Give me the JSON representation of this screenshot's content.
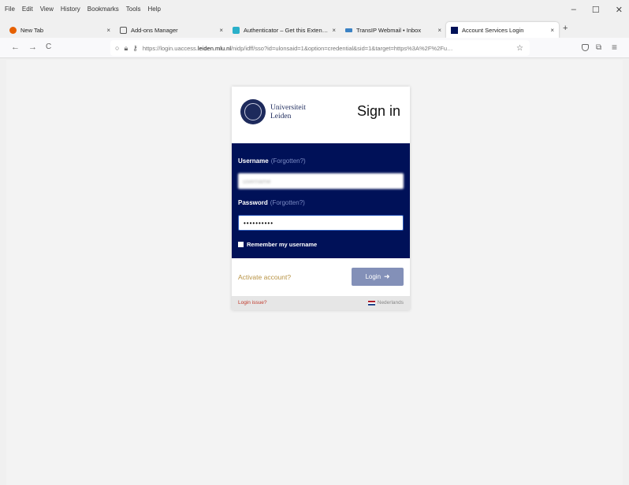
{
  "menu": [
    "File",
    "Edit",
    "View",
    "History",
    "Bookmarks",
    "Tools",
    "Help"
  ],
  "window_controls": [
    "–",
    "☐",
    "✕"
  ],
  "tabs": [
    {
      "title": "New Tab",
      "icon": "firefox-icon",
      "color": "#e66000"
    },
    {
      "title": "Add-ons Manager",
      "icon": "puzzle-icon",
      "color": "#555555"
    },
    {
      "title": "Authenticator – Get this Exten…",
      "icon": "addon-icon",
      "color": "#2ab0c9"
    },
    {
      "title": "TransIP Webmail • Inbox",
      "icon": "transip-icon",
      "color": "#3b82c4"
    },
    {
      "title": "Account Services Login",
      "icon": "leiden-icon",
      "color": "#001158"
    }
  ],
  "new_tab_label": "+",
  "tab_close": "×",
  "nav": {
    "back": "←",
    "forward": "→",
    "reload": "C"
  },
  "url": {
    "prefix": "https://login.uaccess.",
    "domain": "leiden.mlu.nl",
    "rest": "/nidp/idff/sso?id=ulonsaid=1&option=credential&sid=1&target=https%3A%2F%2Fu…",
    "star": "☆"
  },
  "toolbar_icons": [
    "pocket-icon",
    "extensions-icon",
    "menu-icon"
  ],
  "login": {
    "university_line1": "Universiteit",
    "university_line2": "Leiden",
    "heading": "Sign in",
    "username_label": "Username",
    "username_forgot": "(Forgotten?)",
    "username_value": "username",
    "password_label": "Password",
    "password_forgot": "(Forgotten?)",
    "password_value": "••••••••••",
    "remember_label": "Remember my username",
    "activate_link": "Activate account?",
    "login_button": "Login",
    "login_issue": "Login issue?",
    "language": "Nederlands",
    "brand_color": "#001158",
    "activate_color": "#b89344"
  }
}
